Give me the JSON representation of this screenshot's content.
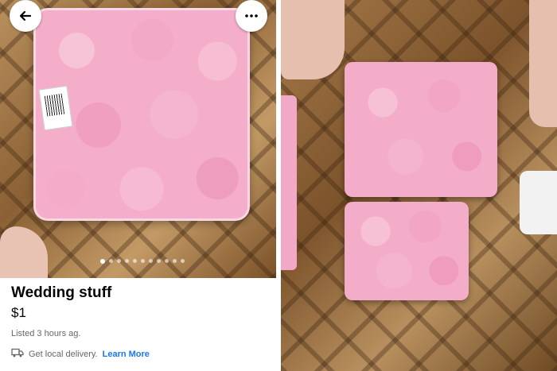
{
  "listing": {
    "title": "Wedding stuff",
    "price": "$1",
    "listed": "Listed 3 hours ag.",
    "delivery_text": "Get local delivery.",
    "learn_more": "Learn More"
  },
  "carousel": {
    "total": 11,
    "active": 0
  },
  "icons": {
    "back": "arrow-left-icon",
    "more": "more-horizontal-icon",
    "delivery": "truck-icon"
  },
  "colors": {
    "link": "#1877f2",
    "muted": "#65676b",
    "text": "#050505"
  }
}
